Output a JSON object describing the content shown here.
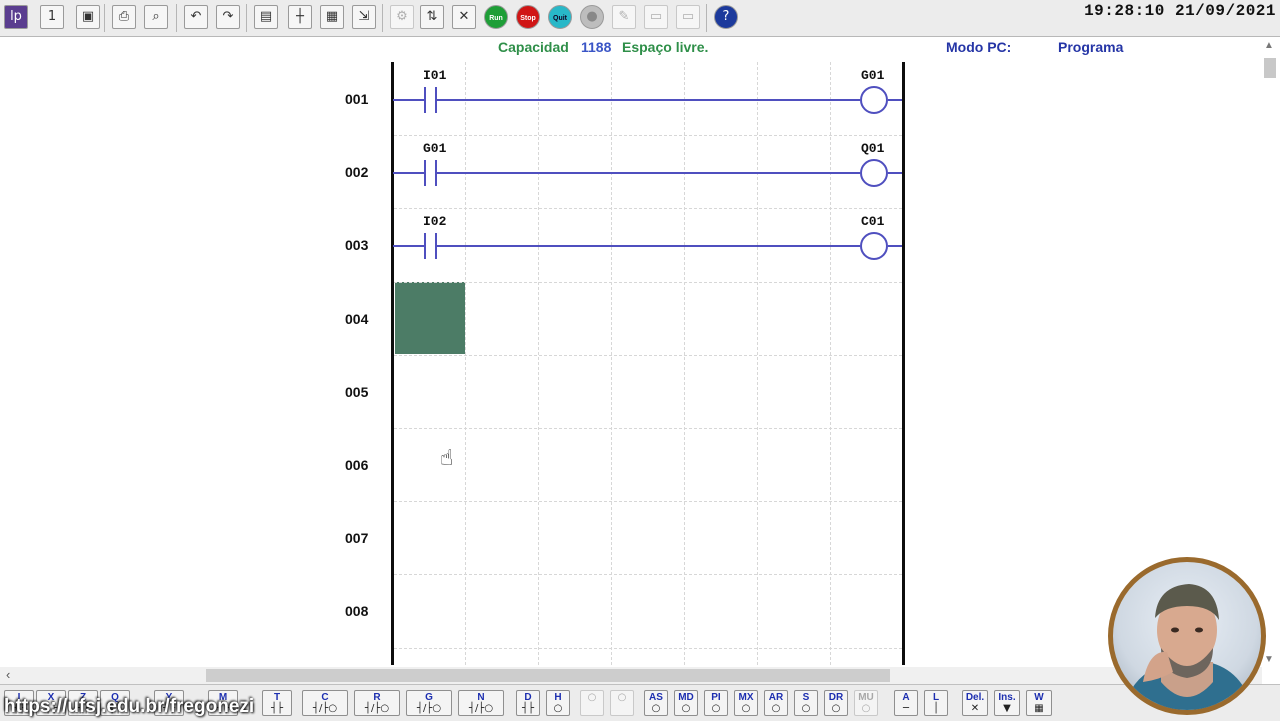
{
  "toolbar": {
    "buttons": [
      {
        "name": "logo",
        "glyph": "lp"
      },
      {
        "name": "one-program",
        "glyph": "1"
      },
      {
        "name": "save",
        "glyph": "▣"
      },
      {
        "name": "print",
        "glyph": "⎙"
      },
      {
        "name": "preview",
        "glyph": "⌕"
      },
      {
        "name": "undo",
        "glyph": "↶"
      },
      {
        "name": "redo",
        "glyph": "↷"
      },
      {
        "name": "monitor",
        "glyph": "▤"
      },
      {
        "name": "edit-net",
        "glyph": "┼"
      },
      {
        "name": "edit-block",
        "glyph": "▦"
      },
      {
        "name": "export",
        "glyph": "⇲"
      },
      {
        "name": "config",
        "glyph": "⚙"
      },
      {
        "name": "transfer",
        "glyph": "⇅"
      },
      {
        "name": "tools",
        "glyph": "✕"
      },
      {
        "name": "run",
        "glyph": "Run"
      },
      {
        "name": "stop",
        "glyph": "Stop"
      },
      {
        "name": "quit",
        "glyph": "Quit"
      },
      {
        "name": "record",
        "glyph": "●"
      },
      {
        "name": "wrench",
        "glyph": "✎"
      },
      {
        "name": "doc",
        "glyph": "▭"
      },
      {
        "name": "doc2",
        "glyph": "▭"
      },
      {
        "name": "help",
        "glyph": "?"
      }
    ],
    "clock": "19:28:10 21/09/2021"
  },
  "info": {
    "capacity_label": "Capacidad",
    "capacity_value": "1188",
    "free_label": "Espaço livre.",
    "mode_label": "Modo PC:",
    "mode_value": "Programa"
  },
  "ladder": {
    "rungs": [
      {
        "number": "001",
        "contact": "I01",
        "coil": "G01"
      },
      {
        "number": "002",
        "contact": "G01",
        "coil": "Q01"
      },
      {
        "number": "003",
        "contact": "I02",
        "coil": "C01"
      },
      {
        "number": "004"
      },
      {
        "number": "005"
      },
      {
        "number": "006"
      },
      {
        "number": "007"
      },
      {
        "number": "008"
      }
    ]
  },
  "bottom_toolbar": {
    "buttons": [
      {
        "label": "I",
        "sym": "┤├",
        "enabled": true
      },
      {
        "label": "X",
        "sym": "┤├",
        "enabled": true
      },
      {
        "label": "Z",
        "sym": "┤├",
        "enabled": true
      },
      {
        "label": "Q",
        "sym": "┤├",
        "enabled": true
      },
      {
        "label": "Y",
        "sym": "┤├",
        "enabled": true
      },
      {
        "label": "M",
        "sym": "┤├",
        "enabled": true
      },
      {
        "label": "T",
        "sym": "┤├",
        "enabled": true
      },
      {
        "label": "C",
        "sym": "┤/├○",
        "enabled": true
      },
      {
        "label": "R",
        "sym": "┤/├○",
        "enabled": true
      },
      {
        "label": "G",
        "sym": "┤/├○",
        "enabled": true
      },
      {
        "label": "N",
        "sym": "┤/├○",
        "enabled": true
      },
      {
        "label": "D",
        "sym": "┤├",
        "enabled": true
      },
      {
        "label": "H",
        "sym": "○",
        "enabled": true
      },
      {
        "label": "",
        "sym": "○",
        "enabled": false
      },
      {
        "label": "",
        "sym": "○",
        "enabled": false
      },
      {
        "label": "AS",
        "sym": "○",
        "enabled": true
      },
      {
        "label": "MD",
        "sym": "○",
        "enabled": true
      },
      {
        "label": "PI",
        "sym": "○",
        "enabled": true
      },
      {
        "label": "MX",
        "sym": "○",
        "enabled": true
      },
      {
        "label": "AR",
        "sym": "○",
        "enabled": true
      },
      {
        "label": "S",
        "sym": "○",
        "enabled": true
      },
      {
        "label": "DR",
        "sym": "○",
        "enabled": true
      },
      {
        "label": "MU",
        "sym": "○",
        "enabled": false
      },
      {
        "label": "A",
        "sym": "─",
        "enabled": true
      },
      {
        "label": "L",
        "sym": "│",
        "enabled": true
      },
      {
        "label": "Del.",
        "sym": "✕",
        "enabled": true
      },
      {
        "label": "Ins.",
        "sym": "▼",
        "enabled": true
      },
      {
        "label": "W",
        "sym": "▦",
        "enabled": true
      }
    ]
  },
  "overlay": {
    "url": "https://ufsj.edu.br/fregonezi"
  },
  "colors": {
    "wire": "#4f4fbf",
    "cursor_cell": "#4c7c66",
    "info_green": "#2f8f49",
    "info_blue": "#2535a6"
  }
}
